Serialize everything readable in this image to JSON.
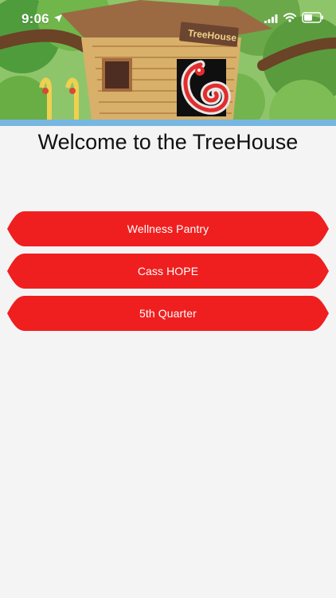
{
  "status_bar": {
    "time": "9:06"
  },
  "header": {
    "sign_text": "TreeHouse"
  },
  "main": {
    "title": "Welcome to the TreeHouse",
    "buttons": [
      {
        "label": "Wellness Pantry"
      },
      {
        "label": "Cass HOPE"
      },
      {
        "label": "5th Quarter"
      }
    ]
  },
  "colors": {
    "button_red": "#ef1f1f",
    "background": "#f4f4f5",
    "title": "#111111"
  },
  "icons": {
    "status": [
      "location-arrow-icon",
      "signal-icon",
      "wifi-icon",
      "battery-icon"
    ],
    "logo": "squirrel-logo-icon"
  }
}
